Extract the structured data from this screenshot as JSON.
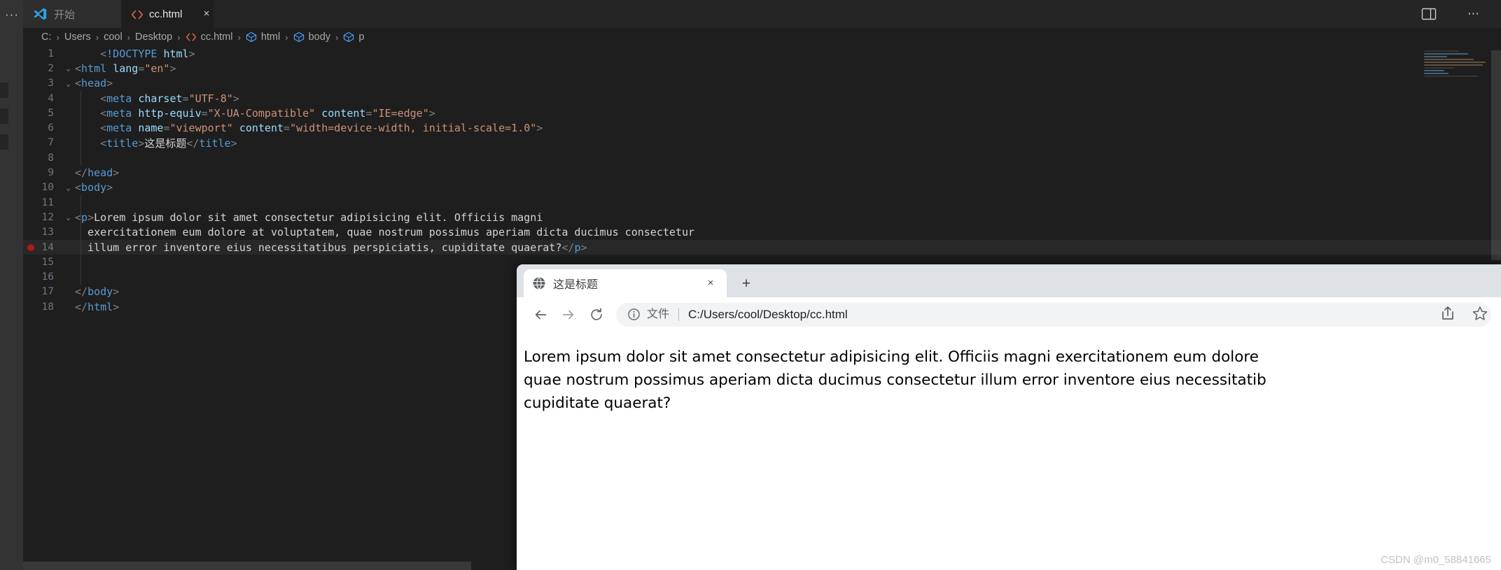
{
  "editor": {
    "activity_bar": {
      "more_icon": "ellipsis-icon"
    },
    "tabs": [
      {
        "label": "开始",
        "icon": "vscode-logo-icon",
        "active": false
      },
      {
        "label": "cc.html",
        "icon": "html-file-icon",
        "active": true,
        "close": "×"
      }
    ],
    "titlebar_actions": {
      "layout_icon": "split-editor-layout-icon",
      "more": "⋯"
    },
    "breadcrumb": [
      {
        "label": "C:",
        "icon": ""
      },
      {
        "label": "Users",
        "icon": ""
      },
      {
        "label": "cool",
        "icon": ""
      },
      {
        "label": "Desktop",
        "icon": ""
      },
      {
        "label": "cc.html",
        "icon": "html-file-icon"
      },
      {
        "label": "html",
        "icon": "symbol-cube-icon"
      },
      {
        "label": "body",
        "icon": "symbol-cube-icon"
      },
      {
        "label": "p",
        "icon": "symbol-cube-icon"
      }
    ],
    "breadcrumb_separator": "›",
    "lines": [
      {
        "n": "1",
        "fold": "",
        "guide": 0,
        "current": false,
        "breakpoint": false,
        "tokens": [
          {
            "c": "t-pun",
            "t": "    <"
          },
          {
            "c": "t-dt",
            "t": "!DOCTYPE"
          },
          {
            "c": "t-pun",
            "t": " "
          },
          {
            "c": "t-dtname",
            "t": "html"
          },
          {
            "c": "t-pun",
            "t": ">"
          }
        ]
      },
      {
        "n": "2",
        "fold": "⌄",
        "guide": 0,
        "current": false,
        "breakpoint": false,
        "tokens": [
          {
            "c": "t-pun",
            "t": "<"
          },
          {
            "c": "t-tag",
            "t": "html"
          },
          {
            "c": "t-pun",
            "t": " "
          },
          {
            "c": "t-attr",
            "t": "lang"
          },
          {
            "c": "t-pun",
            "t": "="
          },
          {
            "c": "t-str",
            "t": "\"en\""
          },
          {
            "c": "t-pun",
            "t": ">"
          }
        ]
      },
      {
        "n": "3",
        "fold": "⌄",
        "guide": 0,
        "current": false,
        "breakpoint": false,
        "tokens": [
          {
            "c": "t-pun",
            "t": "<"
          },
          {
            "c": "t-tag",
            "t": "head"
          },
          {
            "c": "t-pun",
            "t": ">"
          }
        ]
      },
      {
        "n": "4",
        "fold": "",
        "guide": 1,
        "current": false,
        "breakpoint": false,
        "tokens": [
          {
            "c": "t-pun",
            "t": "    <"
          },
          {
            "c": "t-tag",
            "t": "meta"
          },
          {
            "c": "t-pun",
            "t": " "
          },
          {
            "c": "t-attr",
            "t": "charset"
          },
          {
            "c": "t-pun",
            "t": "="
          },
          {
            "c": "t-str",
            "t": "\"UTF-8\""
          },
          {
            "c": "t-pun",
            "t": ">"
          }
        ]
      },
      {
        "n": "5",
        "fold": "",
        "guide": 1,
        "current": false,
        "breakpoint": false,
        "tokens": [
          {
            "c": "t-pun",
            "t": "    <"
          },
          {
            "c": "t-tag",
            "t": "meta"
          },
          {
            "c": "t-pun",
            "t": " "
          },
          {
            "c": "t-attr",
            "t": "http-equiv"
          },
          {
            "c": "t-pun",
            "t": "="
          },
          {
            "c": "t-str",
            "t": "\"X-UA-Compatible\""
          },
          {
            "c": "t-pun",
            "t": " "
          },
          {
            "c": "t-attr",
            "t": "content"
          },
          {
            "c": "t-pun",
            "t": "="
          },
          {
            "c": "t-str",
            "t": "\"IE=edge\""
          },
          {
            "c": "t-pun",
            "t": ">"
          }
        ]
      },
      {
        "n": "6",
        "fold": "",
        "guide": 1,
        "current": false,
        "breakpoint": false,
        "tokens": [
          {
            "c": "t-pun",
            "t": "    <"
          },
          {
            "c": "t-tag",
            "t": "meta"
          },
          {
            "c": "t-pun",
            "t": " "
          },
          {
            "c": "t-attr",
            "t": "name"
          },
          {
            "c": "t-pun",
            "t": "="
          },
          {
            "c": "t-str",
            "t": "\"viewport\""
          },
          {
            "c": "t-pun",
            "t": " "
          },
          {
            "c": "t-attr",
            "t": "content"
          },
          {
            "c": "t-pun",
            "t": "="
          },
          {
            "c": "t-str",
            "t": "\"width=device-width, initial-scale=1.0\""
          },
          {
            "c": "t-pun",
            "t": ">"
          }
        ]
      },
      {
        "n": "7",
        "fold": "",
        "guide": 1,
        "current": false,
        "breakpoint": false,
        "tokens": [
          {
            "c": "t-pun",
            "t": "    <"
          },
          {
            "c": "t-tag",
            "t": "title"
          },
          {
            "c": "t-pun",
            "t": ">"
          },
          {
            "c": "t-cn",
            "t": "这是标题"
          },
          {
            "c": "t-pun",
            "t": "</"
          },
          {
            "c": "t-tag",
            "t": "title"
          },
          {
            "c": "t-pun",
            "t": ">"
          }
        ]
      },
      {
        "n": "8",
        "fold": "",
        "guide": 1,
        "current": false,
        "breakpoint": false,
        "tokens": []
      },
      {
        "n": "9",
        "fold": "",
        "guide": 0,
        "current": false,
        "breakpoint": false,
        "tokens": [
          {
            "c": "t-pun",
            "t": "</"
          },
          {
            "c": "t-tag",
            "t": "head"
          },
          {
            "c": "t-pun",
            "t": ">"
          }
        ]
      },
      {
        "n": "10",
        "fold": "⌄",
        "guide": 0,
        "current": false,
        "breakpoint": false,
        "tokens": [
          {
            "c": "t-pun",
            "t": "<"
          },
          {
            "c": "t-tag",
            "t": "body"
          },
          {
            "c": "t-pun",
            "t": ">"
          }
        ]
      },
      {
        "n": "11",
        "fold": "",
        "guide": 1,
        "current": false,
        "breakpoint": false,
        "tokens": []
      },
      {
        "n": "12",
        "fold": "⌄",
        "guide": 1,
        "current": false,
        "breakpoint": false,
        "tokens": [
          {
            "c": "t-pun",
            "t": "<"
          },
          {
            "c": "t-tag",
            "t": "p"
          },
          {
            "c": "t-pun",
            "t": ">"
          },
          {
            "c": "t-txt",
            "t": "Lorem ipsum dolor sit amet consectetur adipisicing elit. Officiis magni"
          }
        ]
      },
      {
        "n": "13",
        "fold": "",
        "guide": 1,
        "current": false,
        "breakpoint": false,
        "tokens": [
          {
            "c": "t-txt",
            "t": "  exercitationem eum dolore at voluptatem, quae nostrum possimus aperiam dicta ducimus consectetur"
          }
        ]
      },
      {
        "n": "14",
        "fold": "",
        "guide": 1,
        "current": true,
        "breakpoint": true,
        "tokens": [
          {
            "c": "t-txt",
            "t": "  illum error inventore eius necessitatibus perspiciatis, cupiditate quaerat?"
          },
          {
            "c": "t-pun",
            "t": "</"
          },
          {
            "c": "t-tag",
            "t": "p"
          },
          {
            "c": "t-pun",
            "t": ">"
          }
        ]
      },
      {
        "n": "15",
        "fold": "",
        "guide": 1,
        "current": false,
        "breakpoint": false,
        "tokens": []
      },
      {
        "n": "16",
        "fold": "",
        "guide": 1,
        "current": false,
        "breakpoint": false,
        "tokens": []
      },
      {
        "n": "17",
        "fold": "",
        "guide": 0,
        "current": false,
        "breakpoint": false,
        "tokens": [
          {
            "c": "t-pun",
            "t": "</"
          },
          {
            "c": "t-tag",
            "t": "body"
          },
          {
            "c": "t-pun",
            "t": ">"
          }
        ]
      },
      {
        "n": "18",
        "fold": "",
        "guide": 0,
        "current": false,
        "breakpoint": false,
        "tokens": [
          {
            "c": "t-pun",
            "t": "</"
          },
          {
            "c": "t-tag",
            "t": "html"
          },
          {
            "c": "t-pun",
            "t": ">"
          }
        ]
      }
    ],
    "overflow_arrow": "›"
  },
  "browser": {
    "tab": {
      "title": "这是标题",
      "favicon": "globe-icon",
      "close_label": "×"
    },
    "new_tab_label": "+",
    "nav": {
      "back": "←",
      "forward": "→",
      "reload": "reload-icon"
    },
    "omnibox": {
      "info_icon": "info-circle-icon",
      "scheme_label": "文件",
      "url": "C:/Users/cool/Desktop/cc.html"
    },
    "actions": {
      "share_icon": "share-icon",
      "bookmark_icon": "star-icon"
    },
    "page_text": "Lorem ipsum dolor sit amet consectetur adipisicing elit. Officiis magni exercitationem eum dolore\nquae nostrum possimus aperiam dicta ducimus consectetur illum error inventore eius necessitatib\ncupiditate quaerat?"
  },
  "watermark": "CSDN @m0_58841665",
  "colors": {
    "editor_bg": "#1e1e1e",
    "tabbar_bg": "#252526",
    "activity_bg": "#333333",
    "tag": "#569cd6",
    "attr": "#9cdcfe",
    "string": "#ce9178",
    "text": "#d4d4d4",
    "breakpoint": "#b01818",
    "browser_chrome": "#dee1e6"
  }
}
